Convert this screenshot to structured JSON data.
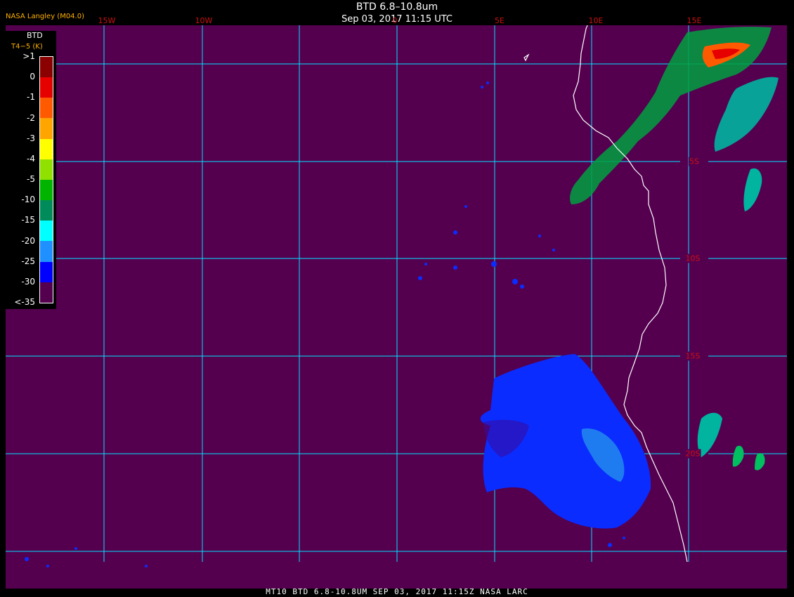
{
  "header": {
    "product": "BTD 6.8–10.8um",
    "datetime": "Sep 03, 2017 11:15 UTC",
    "credit": "NASA Langley (M04.0)"
  },
  "longitude_labels": [
    "15W",
    "10W",
    "0",
    "5E",
    "10E",
    "15E"
  ],
  "latitude_labels": [
    "5S",
    "10S",
    "15S",
    "20S"
  ],
  "legend": {
    "title": "BTD",
    "subtitle": "T4−5 (K)",
    "labels": [
      ">1",
      "0",
      "-1",
      "-2",
      "-3",
      "-4",
      "-5",
      "-10",
      "-15",
      "-20",
      "-25",
      "-30",
      "<-35"
    ],
    "colors": [
      "#8b0000",
      "#e60000",
      "#ff5a00",
      "#ffa500",
      "#ffff00",
      "#90e000",
      "#00b400",
      "#008c5a",
      "#00ffff",
      "#1e90ff",
      "#0000ff",
      "#54004f"
    ]
  },
  "colors": {
    "background": "#54004f",
    "gridline": "#00e5ff",
    "coastline": "#ffffff",
    "label_red": "#cc1111",
    "label_orange": "#ffb000"
  },
  "footer": "MT10   BTD 6.8-10.8UM   SEP 03, 2017 11:15Z   NASA LARC"
}
